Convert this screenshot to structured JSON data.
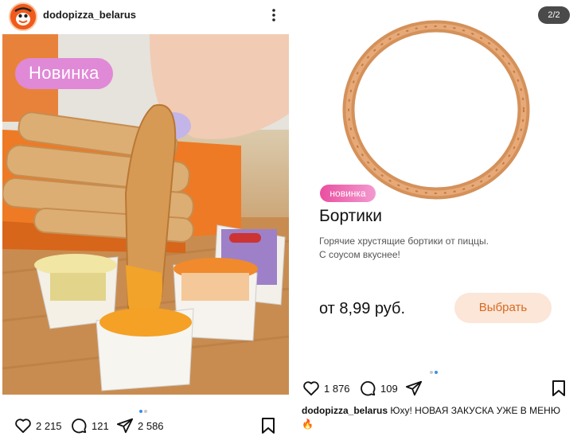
{
  "left_post": {
    "username": "dodopizza_belarus",
    "badge": "Новинка",
    "likes": "2 215",
    "comments": "121",
    "shares": "2 586",
    "icons": {
      "avatar": "dodo-logo",
      "more": "more-vertical-icon",
      "like": "heart-icon",
      "comment": "comment-icon",
      "share": "send-icon",
      "save": "bookmark-icon"
    }
  },
  "right_post": {
    "pager": "2/2",
    "badge": "новинка",
    "product_title": "Бортики",
    "description_line1": "Горячие хрустящие бортики от пиццы.",
    "description_line2": "С соусом вкуснее!",
    "price": "от 8,99 руб.",
    "cta_label": "Выбрать",
    "likes": "1 876",
    "comments": "109",
    "caption_user": "dodopizza_belarus",
    "caption_text": "Юху! НОВАЯ ЗАКУСКА УЖЕ В МЕНЮ",
    "caption_emoji": "🔥"
  },
  "colors": {
    "accent_orange": "#d76a20",
    "badge_pink": "#e089d6",
    "dot_active": "#3b8fe8"
  }
}
